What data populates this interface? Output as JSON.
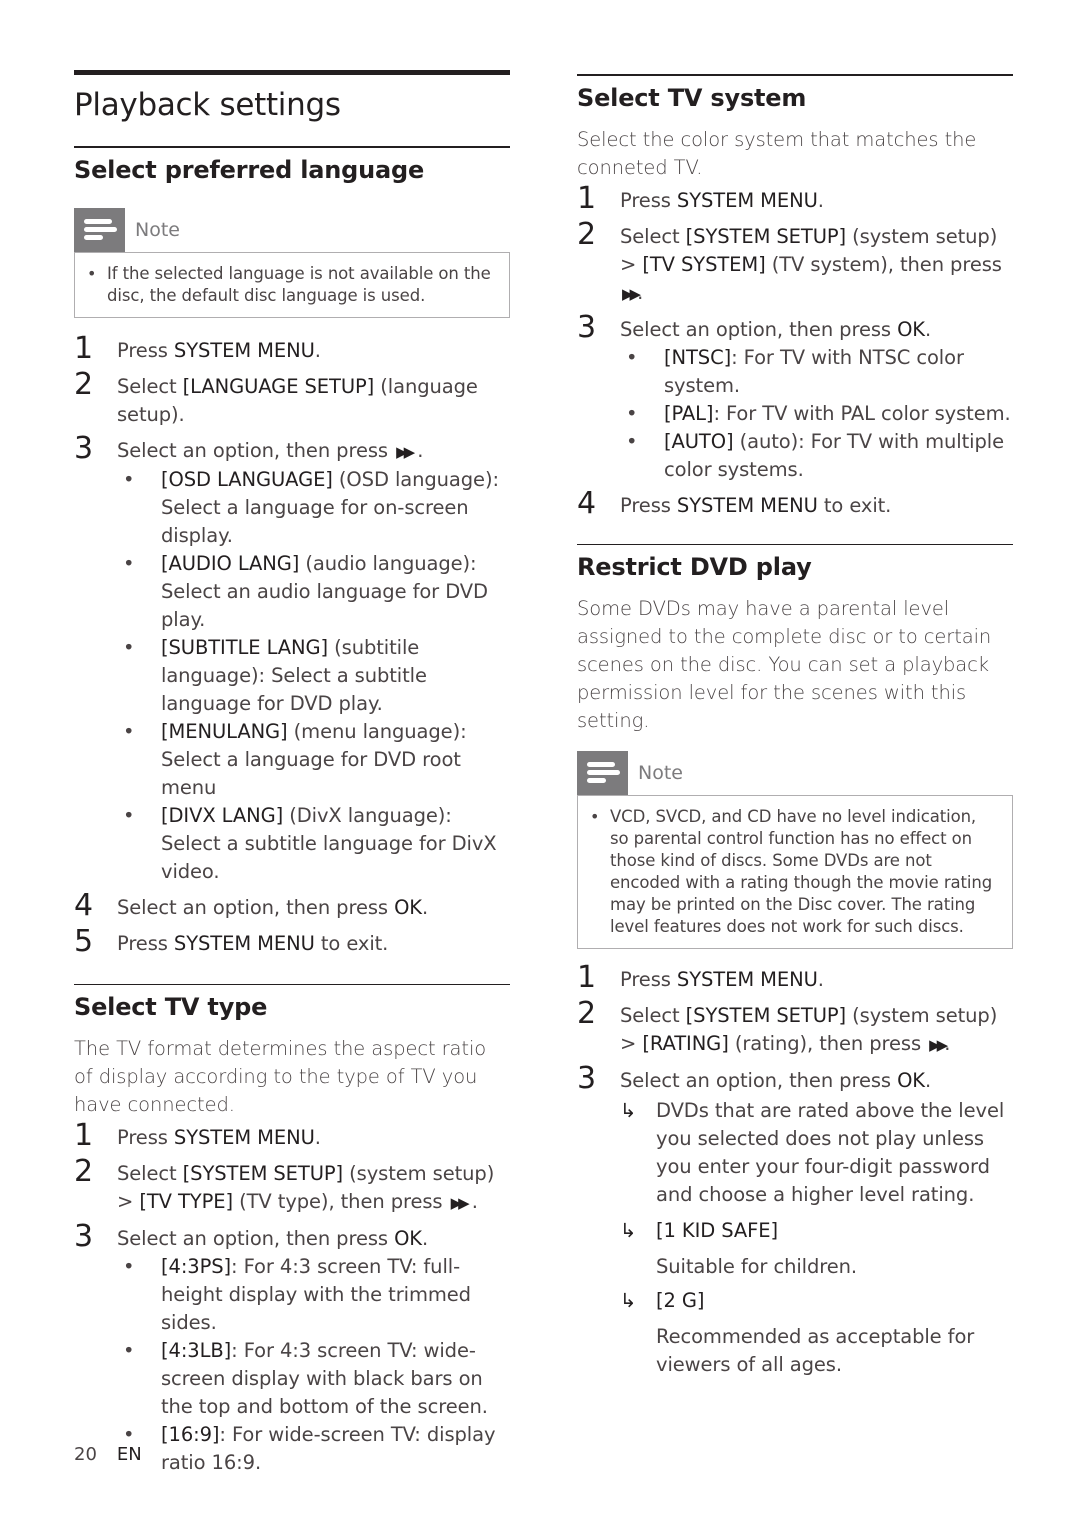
{
  "page_title": "Playback settings",
  "colors": {
    "text": "#231f20",
    "body_text": "#4a4445",
    "note_icon_bg": "#7c7b7d",
    "note_border": "#b0aeb0"
  },
  "sections": {
    "language": {
      "title": "Select preferred language",
      "note": {
        "label": "Note",
        "icon": "note-icon",
        "items": [
          "If the selected language is not available on the disc, the default disc language is used."
        ]
      },
      "steps": [
        {
          "num": "1",
          "pre": "Press ",
          "bold": "SYSTEM MENU",
          "post": "."
        },
        {
          "num": "2",
          "pre": "Select ",
          "bold": "[LANGUAGE SETUP]",
          "post": " (language setup)."
        },
        {
          "num": "3",
          "pre": "Select an option, then press ",
          "icon": "fast-forward-icon",
          "icon_glyph": "▶▶",
          "post": " ."
        },
        {
          "num": "4",
          "pre": "Select an option, then press ",
          "bold": "OK",
          "post": "."
        },
        {
          "num": "5",
          "pre": "Press ",
          "bold": "SYSTEM MENU",
          "post": " to exit."
        }
      ],
      "options": [
        {
          "bold": "[OSD LANGUAGE]",
          "text": " (OSD language): Select a language for on-screen display."
        },
        {
          "bold": "[AUDIO LANG]",
          "text": " (audio language): Select an audio language for DVD play."
        },
        {
          "bold": "[SUBTITLE LANG]",
          "text": " (subtitile language): Select a subtitle language for DVD play."
        },
        {
          "bold": "[MENULANG]",
          "text": " (menu language): Select a language for DVD root menu"
        },
        {
          "bold": "[DIVX LANG]",
          "text": " (DivX language): Select a subtitle language for DivX video."
        }
      ]
    },
    "tv_type": {
      "title": "Select TV type",
      "intro": "The TV format determines the aspect ratio of display according to the type of TV you have connected.",
      "steps": [
        {
          "num": "1",
          "pre": "Press ",
          "bold": "SYSTEM MENU",
          "post": "."
        },
        {
          "num": "2",
          "pre": "Select ",
          "bold": "[SYSTEM SETUP]",
          "mid": " (system setup) > ",
          "bold2": "[TV TYPE]",
          "post": " (TV type), then press ",
          "icon_glyph": "▶▶",
          "post2": " ."
        },
        {
          "num": "3",
          "pre": "Select an option, then press ",
          "bold": "OK",
          "post": "."
        }
      ],
      "options": [
        {
          "bold": "[4:3PS]",
          "text": ": For 4:3 screen TV: full-height display with the trimmed sides."
        },
        {
          "bold": "[4:3LB]",
          "text": ": For 4:3 screen TV: wide-screen display with black bars on the top and bottom of the screen."
        },
        {
          "bold": "[16:9]",
          "text": ": For wide-screen TV: display ratio 16:9."
        }
      ]
    },
    "tv_system": {
      "title": "Select TV system",
      "intro": "Select the color system that matches the conneted TV.",
      "steps": [
        {
          "num": "1",
          "pre": "Press ",
          "bold": "SYSTEM MENU",
          "post": "."
        },
        {
          "num": "2",
          "pre": "Select ",
          "bold": "[SYSTEM SETUP]",
          "mid": " (system setup) > ",
          "bold2": "[TV SYSTEM]",
          "post": " (TV system), then press ",
          "icon_glyph": "▶▶",
          "post2": "."
        },
        {
          "num": "3",
          "pre": "Select an option, then press ",
          "bold": "OK",
          "post": "."
        },
        {
          "num": "4",
          "pre": "Press ",
          "bold": "SYSTEM MENU",
          "post": " to exit."
        }
      ],
      "options": [
        {
          "bold": "[NTSC]",
          "text": ": For TV with NTSC color system."
        },
        {
          "bold": "[PAL]",
          "text": ": For TV with PAL color system."
        },
        {
          "bold": "[AUTO]",
          "text": " (auto): For TV with multiple color systems."
        }
      ]
    },
    "restrict": {
      "title": "Restrict DVD play",
      "intro": "Some DVDs may have a parental level assigned to the complete disc or to certain scenes on the disc. You can set a playback permission level for the scenes with this setting.",
      "note": {
        "label": "Note",
        "icon": "note-icon",
        "items": [
          "VCD, SVCD, and CD have no level indication, so parental control function has no effect on those kind of discs. Some DVDs are not encoded with a rating though the movie rating may be printed on the Disc cover. The rating level features does not work for such discs."
        ]
      },
      "steps": [
        {
          "num": "1",
          "pre": "Press ",
          "bold": "SYSTEM MENU",
          "post": "."
        },
        {
          "num": "2",
          "pre": "Select ",
          "bold": "[SYSTEM SETUP]",
          "mid": " (system setup) > ",
          "bold2": "[RATING]",
          "post": " (rating), then press ",
          "icon_glyph": "▶▶",
          "post2": "."
        },
        {
          "num": "3",
          "pre": "Select an option, then press ",
          "bold": "OK",
          "post": "."
        }
      ],
      "results": [
        {
          "arrow": "↳",
          "text": "DVDs that are rated above the level you selected does not play unless you enter your four-digit password and choose a higher level rating."
        },
        {
          "arrow": "↳",
          "text": "[1 KID SAFE]",
          "desc": "Suitable for children."
        },
        {
          "arrow": "↳",
          "text": "[2 G]",
          "desc": "Recommended as acceptable for viewers of all ages."
        }
      ]
    }
  },
  "footer": {
    "page_number": "20",
    "language": "EN"
  },
  "bullet": "•"
}
